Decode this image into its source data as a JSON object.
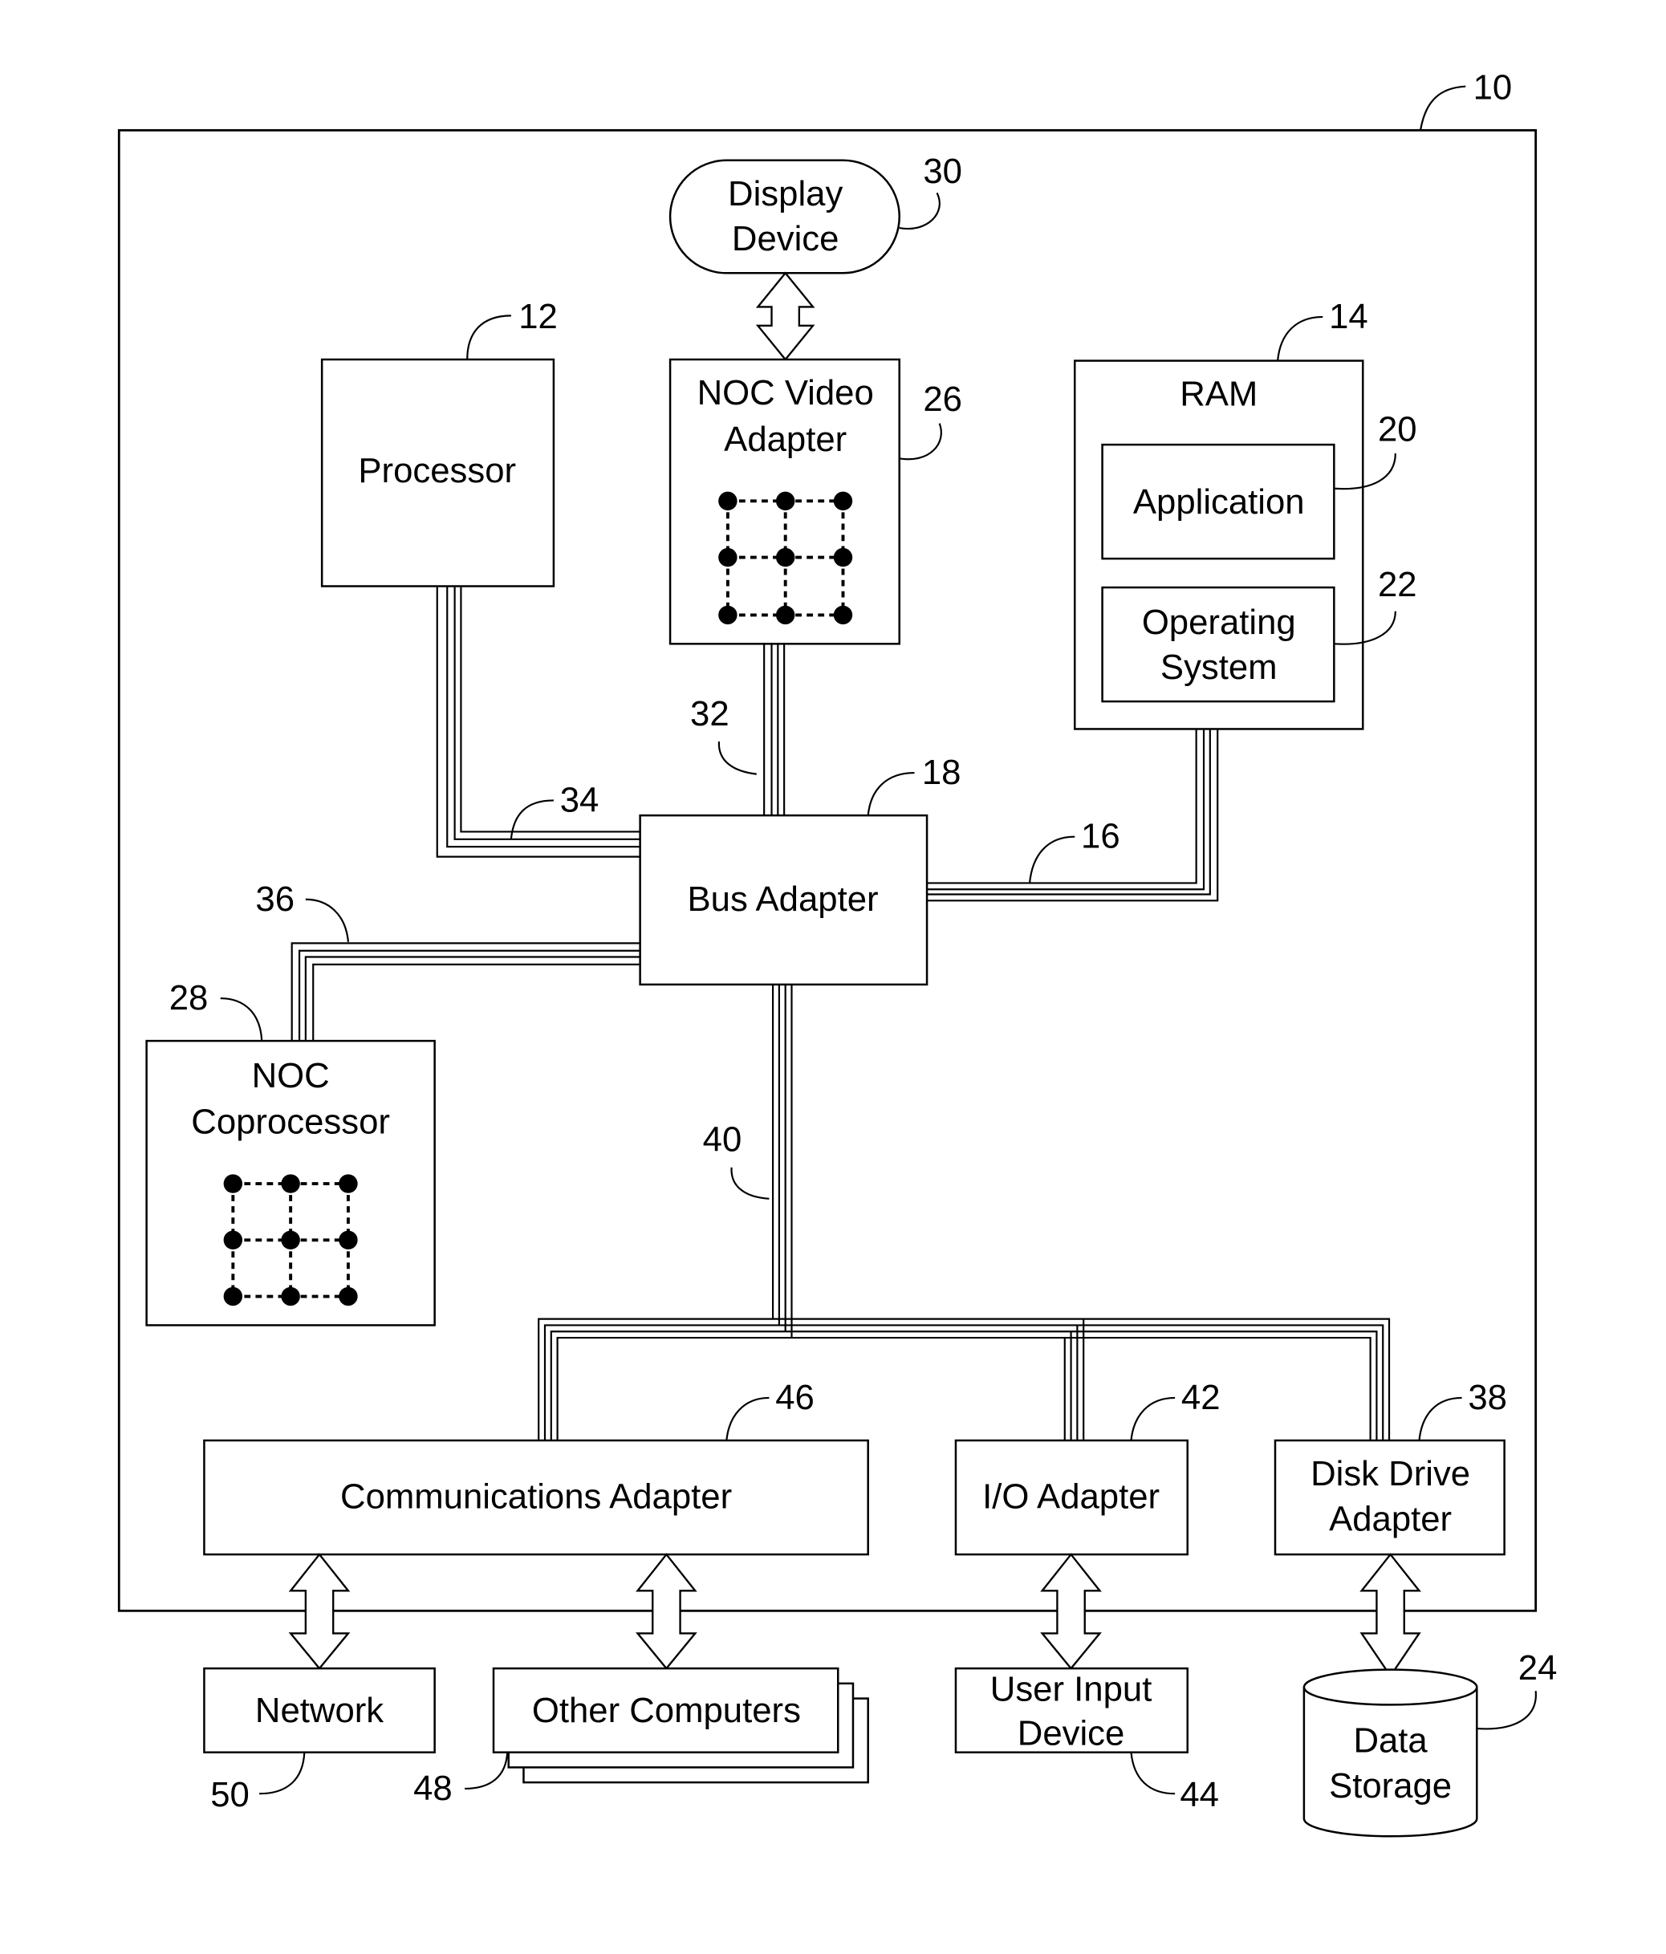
{
  "figure": {
    "system_ref": "10",
    "components": {
      "display_device": {
        "label_lines": [
          "Display",
          "Device"
        ],
        "ref": "30"
      },
      "processor": {
        "label": "Processor",
        "ref": "12"
      },
      "noc_video_adapter": {
        "label_lines": [
          "NOC Video",
          "Adapter"
        ],
        "ref": "26"
      },
      "ram": {
        "label": "RAM",
        "ref": "14"
      },
      "application": {
        "label": "Application",
        "ref": "20"
      },
      "operating_system": {
        "label_lines": [
          "Operating",
          "System"
        ],
        "ref": "22"
      },
      "bus_adapter": {
        "label": "Bus Adapter",
        "ref": "18"
      },
      "noc_coprocessor": {
        "label_lines": [
          "NOC",
          "Coprocessor"
        ],
        "ref": "28"
      },
      "communications_adapter": {
        "label": "Communications Adapter",
        "ref": "46"
      },
      "io_adapter": {
        "label": "I/O Adapter",
        "ref": "42"
      },
      "disk_drive_adapter": {
        "label_lines": [
          "Disk Drive",
          "Adapter"
        ],
        "ref": "38"
      },
      "network": {
        "label": "Network",
        "ref": "50"
      },
      "other_computers": {
        "label": "Other Computers",
        "ref": "48"
      },
      "user_input_device": {
        "label_lines": [
          "User Input",
          "Device"
        ],
        "ref": "44"
      },
      "data_storage": {
        "label_lines": [
          "Data",
          "Storage"
        ],
        "ref": "24"
      }
    },
    "buses": {
      "video_bus": "32",
      "front_side_bus": "34",
      "memory_bus": "16",
      "coprocessor_bus": "36",
      "expansion_bus": "40"
    }
  }
}
